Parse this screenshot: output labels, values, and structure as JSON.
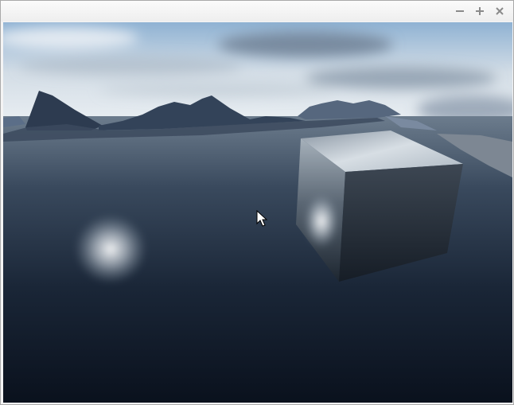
{
  "window": {
    "title": "",
    "controls": {
      "minimize_icon": "minimize-icon",
      "maximize_icon": "maximize-icon",
      "close_icon": "close-icon"
    }
  },
  "scene": {
    "description_icon": "3d-scene",
    "colors": {
      "sky_top": "#8fb2d3",
      "sky_horizon": "#e9eef2",
      "water_far": "#5e6e80",
      "water_near": "#0a1220",
      "mountains": "#2e3d52",
      "cube_top": "#bcc7cf",
      "cube_side": "#1c242e"
    }
  }
}
